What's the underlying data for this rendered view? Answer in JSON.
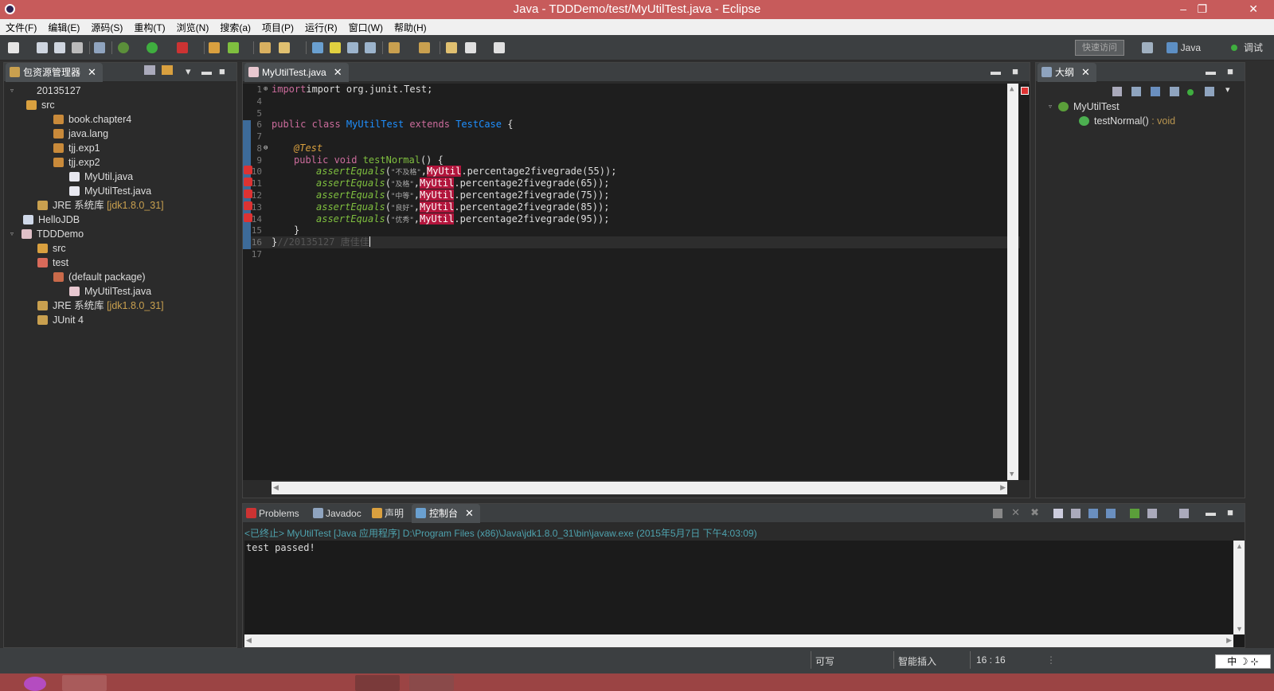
{
  "window": {
    "title": "Java - TDDDemo/test/MyUtilTest.java - Eclipse",
    "minimize": "–",
    "restore": "❐",
    "close": "✕"
  },
  "menu": [
    "文件(F)",
    "编辑(E)",
    "源码(S)",
    "重构(T)",
    "浏览(N)",
    "搜索(a)",
    "项目(P)",
    "运行(R)",
    "窗口(W)",
    "帮助(H)"
  ],
  "toolbar": {
    "quick_access": "快速访问",
    "perspective_java": "Java",
    "perspective_debug": "调试"
  },
  "package_explorer": {
    "title": "包资源管理器",
    "items": [
      {
        "label": "20135127"
      },
      {
        "label": "src"
      },
      {
        "label": "book.chapter4"
      },
      {
        "label": "java.lang"
      },
      {
        "label": "tjj.exp1"
      },
      {
        "label": "tjj.exp2"
      },
      {
        "label": "MyUtil.java"
      },
      {
        "label": "MyUtilTest.java"
      },
      {
        "label": "JRE 系统库",
        "decor": "[jdk1.8.0_31]"
      },
      {
        "label": "HelloJDB"
      },
      {
        "label": "TDDDemo"
      },
      {
        "label": "src"
      },
      {
        "label": "test"
      },
      {
        "label": "(default package)"
      },
      {
        "label": "MyUtilTest.java"
      },
      {
        "label": "JRE 系统库",
        "decor": "[jdk1.8.0_31]"
      },
      {
        "label": "JUnit 4"
      }
    ]
  },
  "editor": {
    "tab": "MyUtilTest.java",
    "lines": {
      "l1n": "1",
      "l1": "import org.junit.Test;",
      "l4n": "4",
      "l5n": "5",
      "l6n": "6",
      "l6a": "public class ",
      "l6b": "MyUtilTest",
      "l6c": " extends ",
      "l6d": "TestCase",
      "l6e": " {",
      "l7n": "7",
      "l8n": "8",
      "l8": "@Test",
      "l9n": "9",
      "l9a": "public void ",
      "l9b": "testNormal",
      "l9c": "() {",
      "call": "assertEquals",
      "myutil": "MyUtil",
      "method": ".percentage2fivegrade(",
      "rows": [
        {
          "n": "10",
          "s": "\"不及格\"",
          "v": "55"
        },
        {
          "n": "11",
          "s": "\"及格\"",
          "v": "65"
        },
        {
          "n": "12",
          "s": "\"中等\"",
          "v": "75"
        },
        {
          "n": "13",
          "s": "\"良好\"",
          "v": "85"
        },
        {
          "n": "14",
          "s": "\"优秀\"",
          "v": "95"
        }
      ],
      "close_paren": "));",
      "l15n": "15",
      "l15": "}",
      "l16n": "16",
      "l16a": "}",
      "l16b": "//20135127 唐佳佳",
      "l17n": "17"
    }
  },
  "outline": {
    "title": "大纲",
    "class": "MyUtilTest",
    "method": "testNormal()",
    "method_type": " : void"
  },
  "bottom_tabs": {
    "problems": "Problems",
    "javadoc": "Javadoc",
    "declaration": "声明",
    "console": "控制台"
  },
  "console": {
    "launch": "<已终止> MyUtilTest [Java 应用程序] D:\\Program Files (x86)\\Java\\jdk1.8.0_31\\bin\\javaw.exe (2015年5月7日 下午4:03:09)",
    "output": "test passed!"
  },
  "status": {
    "writable": "可写",
    "insert_mode": "智能插入",
    "position": "16 : 16",
    "ime": "中 ☽ ⊹"
  }
}
